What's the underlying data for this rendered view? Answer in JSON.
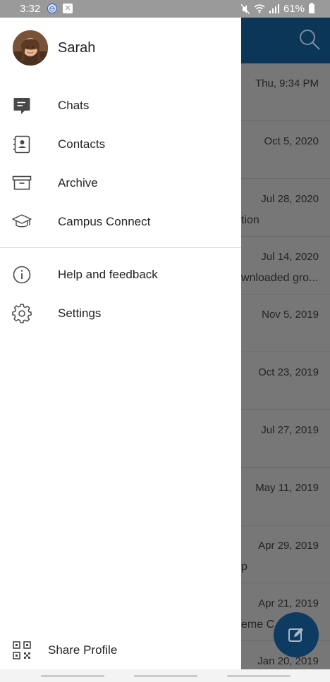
{
  "status_bar": {
    "time": "3:32",
    "battery": "61%"
  },
  "background": {
    "rows": [
      {
        "date": "Thu, 9:34 PM",
        "snippet": ""
      },
      {
        "date": "Oct 5, 2020",
        "snippet": ""
      },
      {
        "date": "Jul 28, 2020",
        "snippet": "tion"
      },
      {
        "date": "Jul 14, 2020",
        "snippet": "wnloaded gro..."
      },
      {
        "date": "Nov 5, 2019",
        "snippet": ""
      },
      {
        "date": "Oct 23, 2019",
        "snippet": ""
      },
      {
        "date": "Jul 27, 2019",
        "snippet": ""
      },
      {
        "date": "May 11, 2019",
        "snippet": ""
      },
      {
        "date": "Apr 29, 2019",
        "snippet": "p"
      },
      {
        "date": "Apr 21, 2019",
        "snippet": "eme C"
      },
      {
        "date": "Jan 20, 2019",
        "snippet": ""
      }
    ]
  },
  "drawer": {
    "user_name": "Sarah",
    "menu": [
      {
        "label": "Chats",
        "icon": "chat-icon"
      },
      {
        "label": "Contacts",
        "icon": "contacts-icon"
      },
      {
        "label": "Archive",
        "icon": "archive-icon"
      },
      {
        "label": "Campus Connect",
        "icon": "graduation-cap-icon"
      }
    ],
    "secondary_menu": [
      {
        "label": "Help and feedback",
        "icon": "info-icon"
      },
      {
        "label": "Settings",
        "icon": "gear-icon"
      }
    ],
    "share_label": "Share Profile"
  },
  "colors": {
    "app_bar": "#0c3657",
    "fab": "#0e3b61",
    "scrim": "#777777"
  }
}
